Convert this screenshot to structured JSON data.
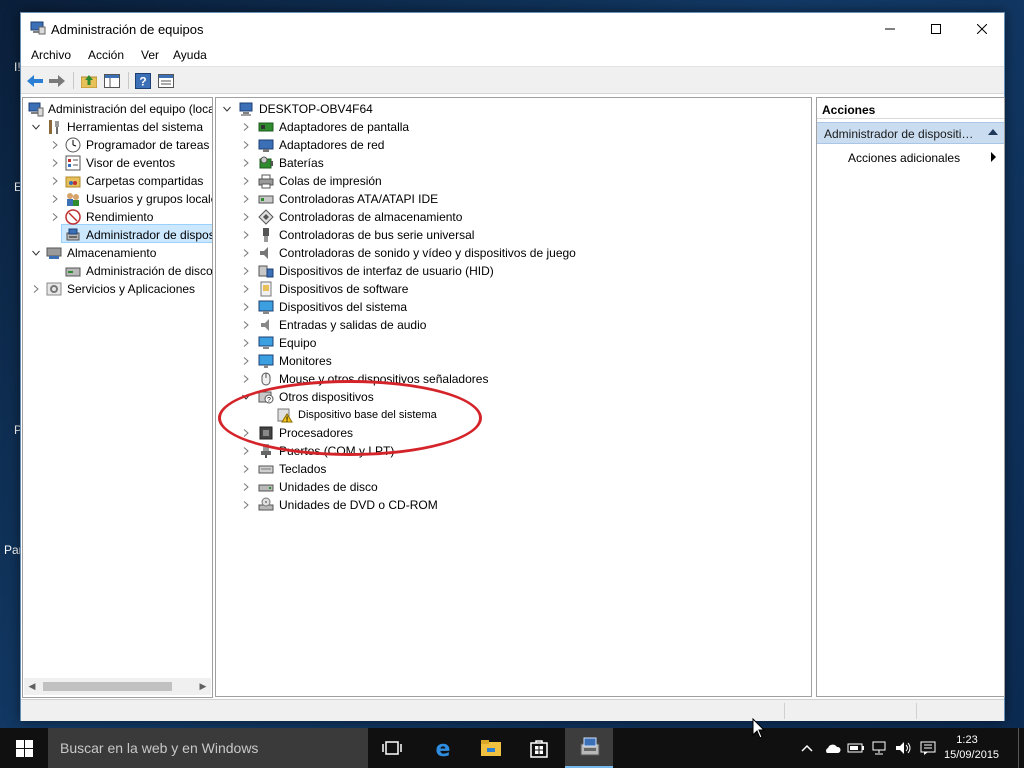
{
  "desktop": {
    "fragments": [
      "I!",
      "E",
      "P",
      "Par"
    ]
  },
  "window": {
    "title": "Administración de equipos",
    "controls": {
      "minimize": "minimize",
      "maximize": "maximize",
      "close": "close"
    }
  },
  "menubar": {
    "items": [
      "Archivo",
      "Acción",
      "Ver",
      "Ayuda"
    ]
  },
  "toolbar": {
    "buttons": [
      "back-arrow-icon",
      "forward-arrow-icon",
      "up-folder-icon",
      "show-hide-console-tree-icon",
      "help-icon",
      "properties-icon"
    ]
  },
  "left_tree": {
    "items": [
      {
        "label": "Administración del equipo (local)",
        "level": 0,
        "expander": "none",
        "icon": "computer-management-icon"
      },
      {
        "label": "Herramientas del sistema",
        "level": 1,
        "expander": "open",
        "icon": "tools-icon"
      },
      {
        "label": "Programador de tareas",
        "level": 2,
        "expander": "closed",
        "icon": "clock-icon"
      },
      {
        "label": "Visor de eventos",
        "level": 2,
        "expander": "closed",
        "icon": "event-viewer-icon"
      },
      {
        "label": "Carpetas compartidas",
        "level": 2,
        "expander": "closed",
        "icon": "shared-folder-icon"
      },
      {
        "label": "Usuarios y grupos locales",
        "level": 2,
        "expander": "closed",
        "icon": "users-icon"
      },
      {
        "label": "Rendimiento",
        "level": 2,
        "expander": "closed",
        "icon": "performance-icon"
      },
      {
        "label": "Administrador de dispositivos",
        "level": 2,
        "expander": "none",
        "icon": "device-manager-icon",
        "selected": true
      },
      {
        "label": "Almacenamiento",
        "level": 1,
        "expander": "open",
        "icon": "storage-icon"
      },
      {
        "label": "Administración de discos",
        "level": 2,
        "expander": "none",
        "icon": "disk-icon"
      },
      {
        "label": "Servicios y Aplicaciones",
        "level": 1,
        "expander": "closed",
        "icon": "services-icon"
      }
    ]
  },
  "device_tree": {
    "root": {
      "label": "DESKTOP-OBV4F64",
      "icon": "computer-icon"
    },
    "items": [
      {
        "label": "Adaptadores de pantalla",
        "icon": "display-adapter-icon",
        "expander": "closed"
      },
      {
        "label": "Adaptadores de red",
        "icon": "network-adapter-icon",
        "expander": "closed"
      },
      {
        "label": "Baterías",
        "icon": "battery-icon",
        "expander": "closed"
      },
      {
        "label": "Colas de impresión",
        "icon": "printer-icon",
        "expander": "closed"
      },
      {
        "label": "Controladoras ATA/ATAPI IDE",
        "icon": "ide-controller-icon",
        "expander": "closed"
      },
      {
        "label": "Controladoras de almacenamiento",
        "icon": "storage-controller-icon",
        "expander": "closed"
      },
      {
        "label": "Controladoras de bus serie universal",
        "icon": "usb-icon",
        "expander": "closed"
      },
      {
        "label": "Controladoras de sonido y vídeo y dispositivos de juego",
        "icon": "sound-icon",
        "expander": "closed"
      },
      {
        "label": "Dispositivos de interfaz de usuario (HID)",
        "icon": "hid-icon",
        "expander": "closed"
      },
      {
        "label": "Dispositivos de software",
        "icon": "software-device-icon",
        "expander": "closed"
      },
      {
        "label": "Dispositivos del sistema",
        "icon": "system-device-icon",
        "expander": "closed"
      },
      {
        "label": "Entradas y salidas de audio",
        "icon": "audio-icon",
        "expander": "closed"
      },
      {
        "label": "Equipo",
        "icon": "computer-icon",
        "expander": "closed"
      },
      {
        "label": "Monitores",
        "icon": "monitor-icon",
        "expander": "closed"
      },
      {
        "label": "Mouse y otros dispositivos señaladores",
        "icon": "mouse-icon",
        "expander": "closed"
      },
      {
        "label": "Otros dispositivos",
        "icon": "unknown-device-icon",
        "expander": "open"
      },
      {
        "label": "Dispositivo base del sistema",
        "icon": "warning-device-icon",
        "expander": "none",
        "child": true
      },
      {
        "label": "Procesadores",
        "icon": "processor-icon",
        "expander": "closed"
      },
      {
        "label": "Puertos (COM y LPT)",
        "icon": "port-icon",
        "expander": "closed"
      },
      {
        "label": "Teclados",
        "icon": "keyboard-icon",
        "expander": "closed"
      },
      {
        "label": "Unidades de disco",
        "icon": "disk-drive-icon",
        "expander": "closed"
      },
      {
        "label": "Unidades de DVD o CD-ROM",
        "icon": "dvd-icon",
        "expander": "closed"
      }
    ]
  },
  "actions": {
    "header": "Acciones",
    "section": "Administrador de dispositivos",
    "item": "Acciones adicionales"
  },
  "taskbar": {
    "search_placeholder": "Buscar en la web y en Windows",
    "apps": [
      "task-view-icon",
      "edge-icon",
      "file-explorer-icon",
      "store-icon",
      "computer-management-icon"
    ],
    "clock": {
      "time": "1:23",
      "date": "15/09/2015"
    }
  },
  "colors": {
    "selection": "#cce8ff",
    "actions_section": "#c9dcf0",
    "annotation": "#d4242a",
    "taskbar": "#101010"
  }
}
